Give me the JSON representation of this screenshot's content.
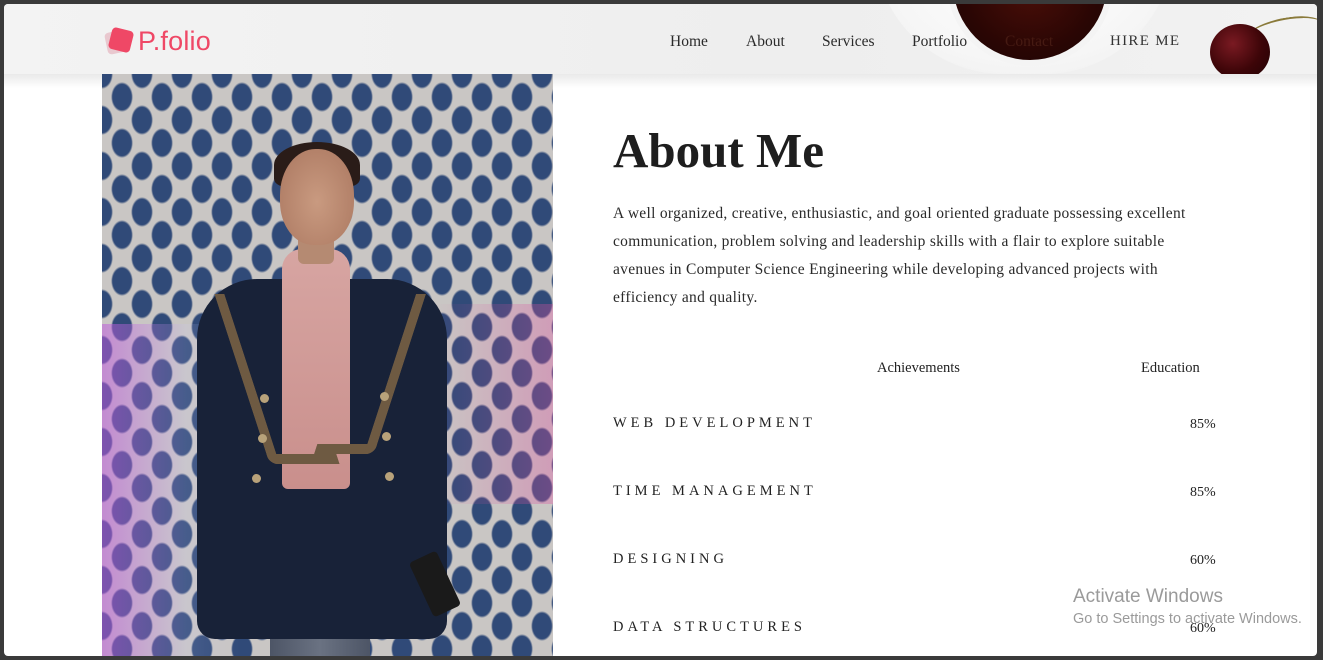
{
  "brand": {
    "logo_text": "P.folio",
    "color": "#ef4866"
  },
  "nav": {
    "items": [
      {
        "label": "Home"
      },
      {
        "label": "About"
      },
      {
        "label": "Services"
      },
      {
        "label": "Portfolio"
      },
      {
        "label": "Contact"
      }
    ],
    "cta": "HIRE ME"
  },
  "photo": {
    "icon": "profile-photo"
  },
  "about": {
    "title": "About Me",
    "description": "A well organized, creative, enthusiastic, and goal oriented graduate possessing excellent communication, problem solving and leadership skills with a flair to explore suitable avenues in Computer Science Engineering while developing advanced projects with efficiency and quality.",
    "tabs": [
      {
        "label": "Achievements"
      },
      {
        "label": "Education"
      }
    ],
    "skills": [
      {
        "name": "WEB DEVELOPMENT",
        "value": "85%"
      },
      {
        "name": "TIME MANAGEMENT",
        "value": "85%"
      },
      {
        "name": "DESIGNING",
        "value": "60%"
      },
      {
        "name": "DATA STRUCTURES",
        "value": "60%"
      }
    ]
  },
  "os_watermark": {
    "line1": "Activate Windows",
    "line2": "Go to Settings to activate Windows."
  }
}
